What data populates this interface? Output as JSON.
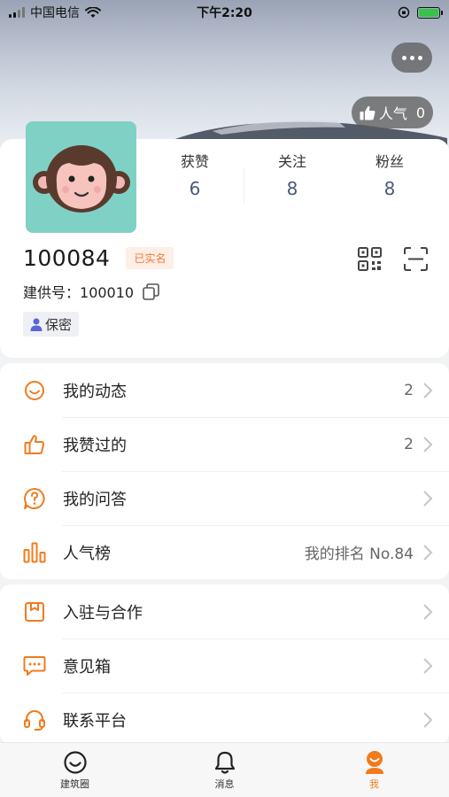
{
  "status_bar": {
    "carrier": "中国电信",
    "time": "下午2:20"
  },
  "header": {
    "popularity_label": "人气",
    "popularity_count": "0"
  },
  "profile": {
    "stats": [
      {
        "label": "获赞",
        "value": "6"
      },
      {
        "label": "关注",
        "value": "8"
      },
      {
        "label": "粉丝",
        "value": "8"
      }
    ],
    "username": "100084",
    "verified_badge": "已实名",
    "jgh_label": "建供号：",
    "jgh_value": "100010",
    "gender": "保密"
  },
  "menu_group_1": [
    {
      "label": "我的动态",
      "value": "2",
      "icon": "smile-icon"
    },
    {
      "label": "我赞过的",
      "value": "2",
      "icon": "thumbs-up-icon"
    },
    {
      "label": "我的问答",
      "value": "",
      "icon": "question-icon"
    },
    {
      "label": "人气榜",
      "value": "我的排名 No.84",
      "icon": "bar-chart-icon"
    }
  ],
  "menu_group_2": [
    {
      "label": "入驻与合作",
      "icon": "bookmark-box-icon"
    },
    {
      "label": "意见箱",
      "icon": "message-dots-icon"
    },
    {
      "label": "联系平台",
      "icon": "headset-icon"
    }
  ],
  "tabbar": {
    "tabs": [
      {
        "label": "建筑圈"
      },
      {
        "label": "消息"
      },
      {
        "label": "我"
      }
    ]
  },
  "colors": {
    "accent": "#f07b1d",
    "stat_value": "#4a5a78",
    "avatar_bg": "#7fd1c6"
  }
}
